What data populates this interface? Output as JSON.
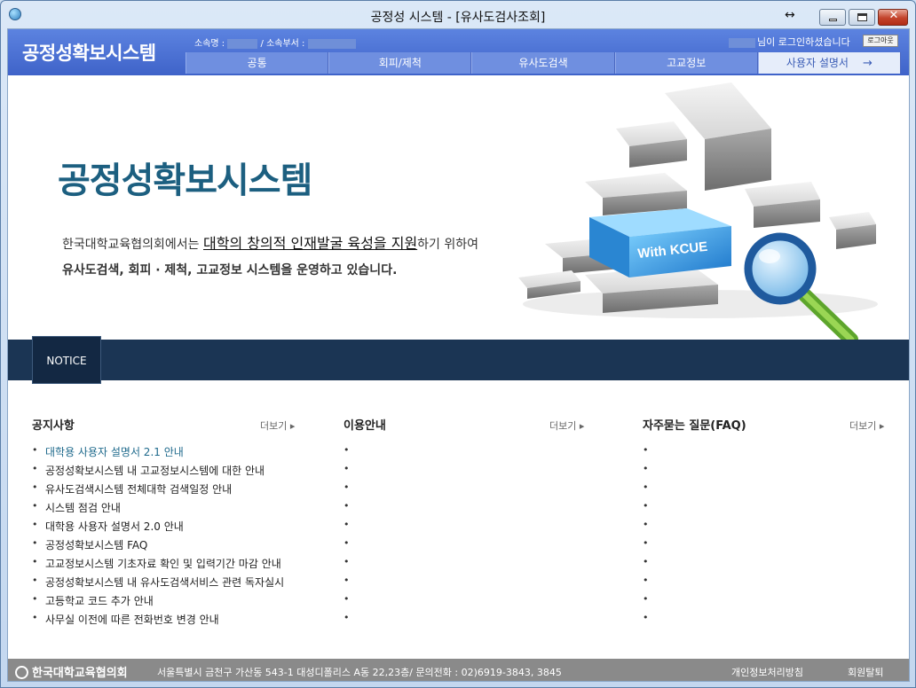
{
  "window": {
    "title": "공정성 시스템 - [유사도검사조회]",
    "resize_glyph": "↔",
    "close_glyph": "✕"
  },
  "header": {
    "brand": "공정성확보시스템",
    "affiliation_label": "소속명 :",
    "department_label": "/ 소속부서 :",
    "login_suffix": "님이 로그인하셨습니다",
    "logout_label": "로그아웃"
  },
  "nav": {
    "items": [
      {
        "label": "공통"
      },
      {
        "label": "회피/제척"
      },
      {
        "label": "유사도검색"
      },
      {
        "label": "고교정보"
      },
      {
        "label": "사용자 설명서"
      }
    ],
    "arrow": "→"
  },
  "hero": {
    "title": "공정성확보시스템",
    "line1_pre": "한국대학교육협의회에서는 ",
    "line1_emph": "대학의 창의적 인재발굴 육성을 지원",
    "line1_post": "하기 위하여",
    "line2": "유사도검색, 회피 · 제척, 고교정보 시스템을 운영하고 있습니다.",
    "graphic_label": "With KCUE"
  },
  "notice": {
    "tab_label": "NOTICE"
  },
  "columns": {
    "notices": {
      "title": "공지사항",
      "more": "더보기 ▸",
      "items": [
        "대학용 사용자 설명서 2.1 안내",
        "공정성확보시스템 내 고교정보시스템에 대한 안내",
        "유사도검색시스템 전체대학 검색일정 안내",
        "시스템 점검 안내",
        "대학용 사용자 설명서 2.0 안내",
        "공정성확보시스템 FAQ",
        "고교정보시스템 기초자료 확인 및 입력기간 마감 안내",
        "공정성확보시스템 내 유사도검색서비스 관련 독자실시",
        "고등학교 코드 추가 안내",
        "사무실 이전에 따른 전화번호 변경 안내"
      ]
    },
    "guide": {
      "title": "이용안내",
      "more": "더보기 ▸",
      "items": [
        "",
        "",
        "",
        "",
        "",
        "",
        "",
        "",
        "",
        ""
      ]
    },
    "faq": {
      "title": "자주묻는 질문(FAQ)",
      "more": "더보기 ▸",
      "items": [
        "",
        "",
        "",
        "",
        "",
        "",
        "",
        "",
        "",
        ""
      ]
    }
  },
  "footer": {
    "logo": "한국대학교육협의회",
    "address": "서울특별시 금천구 가산동 543-1 대성디폴리스 A동 22,23층/ 문의전화 : 02)6919-3843, 3845",
    "privacy": "개인정보처리방침",
    "leave": "회원탈퇴"
  },
  "colors": {
    "header_blue": "#4a6fd6",
    "title_teal": "#1c5f80",
    "notice_navy": "#1b3554",
    "footer_gray": "#8a8a8a"
  }
}
